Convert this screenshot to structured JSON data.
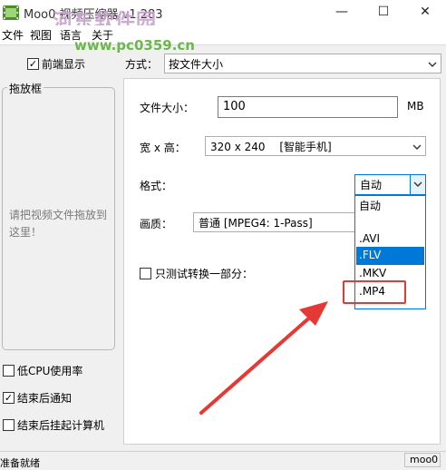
{
  "window": {
    "title": "Moo0 视频压缩器 v1.283",
    "minimize_glyph": "—",
    "maximize_glyph": "☐",
    "close_glyph": "✕"
  },
  "watermark": {
    "site_name": "河东软件园",
    "site_url": "www.pc0359.cn"
  },
  "menu": {
    "items": [
      "文件",
      "视图",
      "语言",
      "关于"
    ]
  },
  "left": {
    "always_on_top": {
      "label": "前端显示",
      "checked": true
    },
    "dropzone_title": "拖放框",
    "dropzone_hint": "请把视频文件拖放到这里！",
    "options": [
      {
        "label": "低CPU使用率",
        "checked": false
      },
      {
        "label": "结束后通知",
        "checked": true
      },
      {
        "label": "结束后挂起计算机",
        "checked": false
      }
    ]
  },
  "method": {
    "label": "方式：",
    "value": "按文件大小"
  },
  "settings": {
    "file_size_label": "文件大小：",
    "file_size_value": "100",
    "file_size_unit": "MB",
    "resolution_label": "宽 x 高：",
    "resolution_value": "320 x 240",
    "resolution_device": "[智能手机]",
    "format_label": "格式：",
    "format_value": "自动",
    "format_options": [
      "自动",
      "",
      ".AVI",
      ".FLV",
      ".MKV",
      ".MP4"
    ],
    "format_highlighted": ".FLV",
    "quality_label": "画质：",
    "quality_value": "普通  [MPEG4: 1-Pass]",
    "test_part_label": "只测试转换一部分：",
    "test_part_checked": false
  },
  "status": {
    "text": "准备就绪",
    "version": "moo0"
  },
  "colors": {
    "accent": "#0078d7",
    "annotation": "#e53935",
    "watermark_green": "#6ab84a"
  },
  "icons": {
    "app": "film-icon",
    "dropdown": "chevron-down-icon"
  }
}
